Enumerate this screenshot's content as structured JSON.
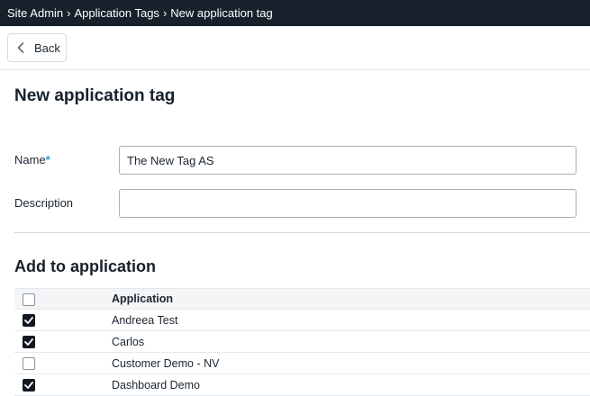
{
  "breadcrumb": {
    "items": [
      "Site Admin",
      "Application Tags",
      "New application tag"
    ],
    "separator": "›"
  },
  "back_button": {
    "label": "Back",
    "icon": "chevron-left-icon"
  },
  "page_title": "New application tag",
  "form": {
    "name": {
      "label": "Name",
      "required_mark": "*",
      "value": "The New Tag AS"
    },
    "description": {
      "label": "Description",
      "value": ""
    }
  },
  "add_section": {
    "title": "Add to application",
    "column_header": "Application",
    "rows": [
      {
        "name": "Andreea Test",
        "checked": true
      },
      {
        "name": "Carlos",
        "checked": true
      },
      {
        "name": "Customer Demo - NV",
        "checked": false
      },
      {
        "name": "Dashboard Demo",
        "checked": true
      }
    ]
  },
  "colors": {
    "topbar_bg": "#17212b",
    "required_accent": "#1aa3c8",
    "checkbox_checked": "#111820"
  }
}
